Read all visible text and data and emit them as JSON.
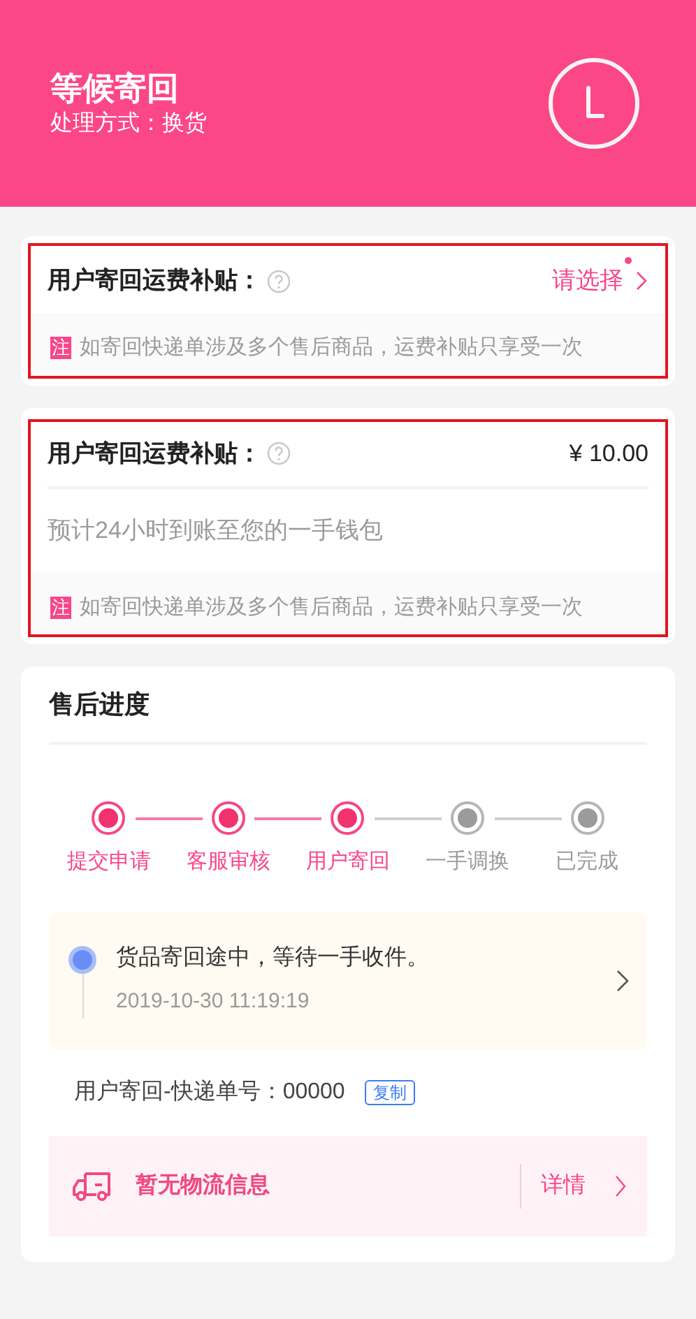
{
  "header": {
    "title": "等候寄回",
    "subtitle": "处理方式：换货"
  },
  "subsidy_select": {
    "highlighted": true,
    "label": "用户寄回运费补贴：",
    "action": "请选择",
    "unread": true,
    "note_tag": "注",
    "note": "如寄回快递单涉及多个售后商品，运费补贴只享受一次"
  },
  "subsidy_amount": {
    "highlighted": true,
    "label": "用户寄回运费补贴：",
    "amount": "¥ 10.00",
    "detail": "预计24小时到账至您的一手钱包",
    "note_tag": "注",
    "note": "如寄回快递单涉及多个售后商品，运费补贴只享受一次"
  },
  "progress": {
    "title": "售后进度",
    "steps": [
      {
        "label": "提交申请",
        "done": true
      },
      {
        "label": "客服审核",
        "done": true
      },
      {
        "label": "用户寄回",
        "done": true
      },
      {
        "label": "一手调换",
        "done": false
      },
      {
        "label": "已完成",
        "done": false
      }
    ],
    "latest": {
      "text": "货品寄回途中，等待一手收件。",
      "time": "2019-10-30 11:19:19"
    },
    "tracking": {
      "label": "用户寄回-快递单号：00000",
      "copy": "复制"
    },
    "logistics": {
      "text": "暂无物流信息",
      "link": "详情"
    }
  }
}
